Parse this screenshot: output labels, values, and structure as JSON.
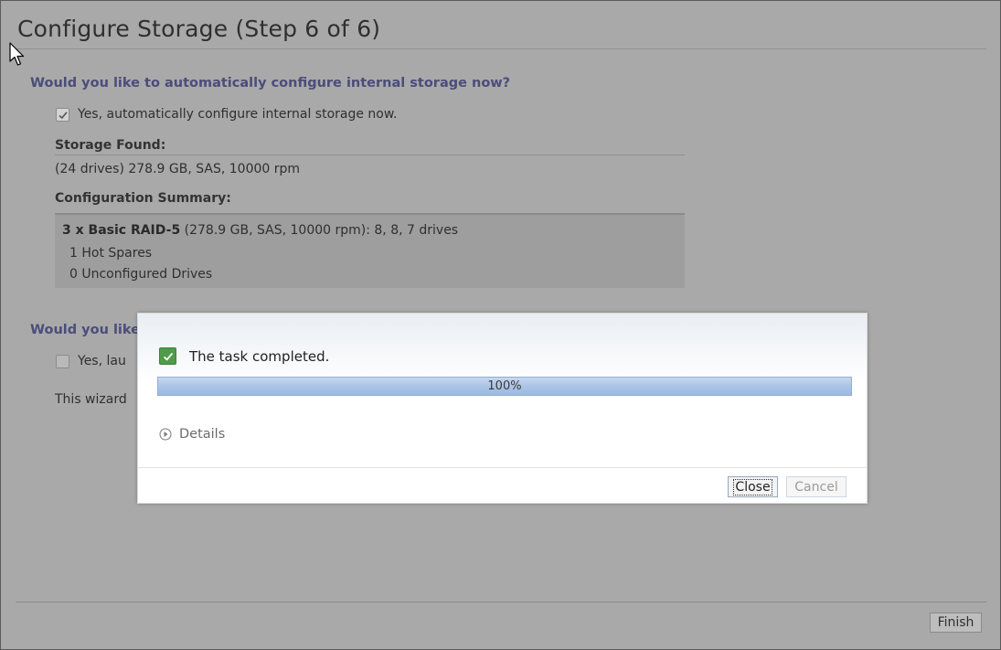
{
  "page": {
    "title": "Configure Storage (Step 6 of 6)"
  },
  "section1": {
    "question": "Would you like to automatically configure internal storage now?",
    "checkbox_label": "Yes, automatically configure internal storage now.",
    "checkbox_checked": true,
    "storage_found_heading": "Storage Found:",
    "storage_found_value": "(24 drives) 278.9 GB, SAS, 10000 rpm",
    "summary_heading": "Configuration Summary:",
    "summary_raid_bold": "3 x Basic RAID-5",
    "summary_raid_rest": " (278.9 GB, SAS, 10000 rpm): 8, 8, 7 drives",
    "summary_hot_spares": "1 Hot Spares",
    "summary_unconfigured": "0 Unconfigured Drives"
  },
  "section2": {
    "question_partial": "Would you like",
    "checkbox_label_partial": "Yes, lau",
    "checkbox_checked": false,
    "info_partial": "This wizard"
  },
  "footer": {
    "finish_label": "Finish"
  },
  "modal": {
    "status_text": "The task completed.",
    "progress": 1.0,
    "progress_label": "100%",
    "details_label": "Details",
    "close_label": "Close",
    "cancel_label": "Cancel"
  },
  "colors": {
    "overlay_gray": "#a9a9a9",
    "section_heading": "#4b4d7a",
    "success_green": "#4f9a4b",
    "progress_fill": "#a9c3e6"
  }
}
